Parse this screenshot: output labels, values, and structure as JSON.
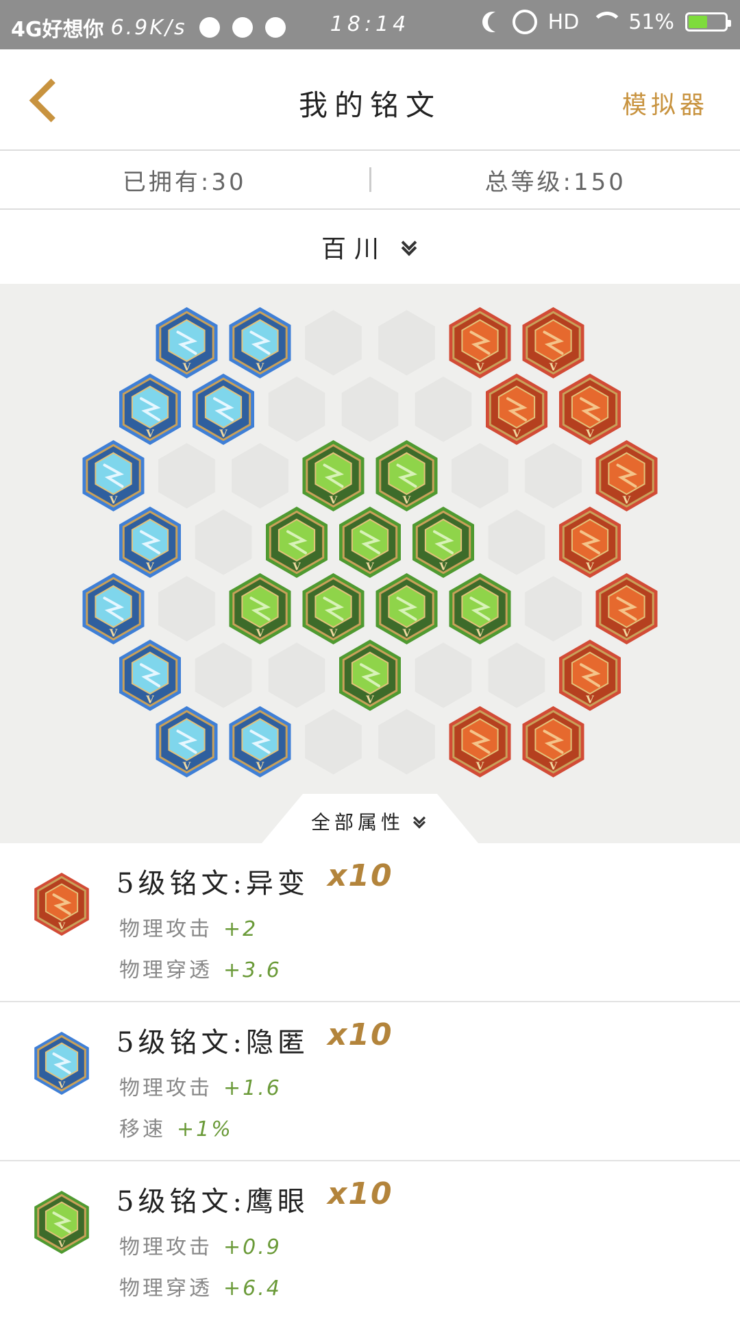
{
  "status_bar": {
    "carrier": "4G好想你",
    "net_speed": "6.9K/s",
    "time": "18:14",
    "hd": "HD",
    "battery_percent": "51%"
  },
  "header": {
    "title": "我的铭文",
    "simulator_label": "模拟器"
  },
  "summary": {
    "owned": "已拥有:30",
    "total_level": "总等级:150"
  },
  "page_selector": {
    "name": "百川"
  },
  "board": {
    "colors": {
      "blue": "#3f7fd6",
      "red": "#d24b36",
      "green": "#4f9a31",
      "empty": "#e6e6e4"
    },
    "rows": [
      [
        "blue",
        "blue",
        "empty",
        "empty",
        "red",
        "red"
      ],
      [
        "blue",
        "blue",
        "empty",
        "empty",
        "empty",
        "red",
        "red"
      ],
      [
        "blue",
        "empty",
        "empty",
        "green",
        "green",
        "empty",
        "empty",
        "red"
      ],
      [
        "blue",
        "empty",
        "green",
        "green",
        "green",
        "empty",
        "red"
      ],
      [
        "blue",
        "empty",
        "green",
        "green",
        "green",
        "green",
        "empty",
        "red"
      ],
      [
        "blue",
        "empty",
        "empty",
        "green",
        "empty",
        "empty",
        "red"
      ],
      [
        "blue",
        "blue",
        "empty",
        "empty",
        "red",
        "red"
      ]
    ]
  },
  "attributes_tab": {
    "label": "全部属性"
  },
  "runes": [
    {
      "color": "red",
      "name": "5级铭文:异变",
      "count": "x10",
      "stats": [
        {
          "label": "物理攻击",
          "value": "+2"
        },
        {
          "label": "物理穿透",
          "value": "+3.6"
        }
      ]
    },
    {
      "color": "blue",
      "name": "5级铭文:隐匿",
      "count": "x10",
      "stats": [
        {
          "label": "物理攻击",
          "value": "+1.6"
        },
        {
          "label": "移速",
          "value": "+1%"
        }
      ]
    },
    {
      "color": "green",
      "name": "5级铭文:鹰眼",
      "count": "x10",
      "stats": [
        {
          "label": "物理攻击",
          "value": "+0.9"
        },
        {
          "label": "物理穿透",
          "value": "+6.4"
        }
      ]
    }
  ]
}
